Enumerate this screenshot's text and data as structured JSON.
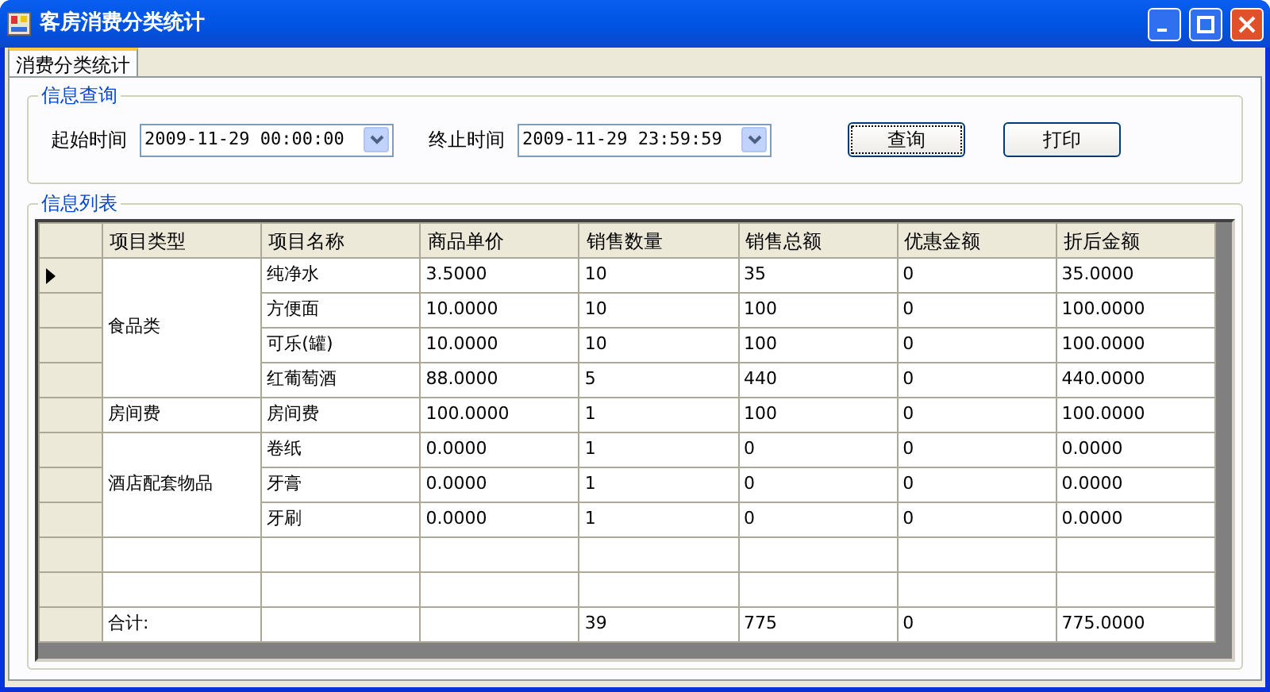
{
  "window": {
    "title": "客房消费分类统计"
  },
  "tabs": [
    {
      "label": "消费分类统计",
      "selected": true
    }
  ],
  "query": {
    "title": "信息查询",
    "start_label": "起始时间",
    "start_value": "2009-11-29 00:00:00",
    "end_label": "终止时间",
    "end_value": "2009-11-29 23:59:59",
    "buttons": [
      {
        "label": "查询",
        "focused": true
      },
      {
        "label": "打印",
        "focused": false
      }
    ]
  },
  "table": {
    "title": "信息列表",
    "columns": [
      "项目类型",
      "项目名称",
      "商品单价",
      "销售数量",
      "销售总额",
      "优惠金额",
      "折后金额"
    ],
    "rows": [
      {
        "kind": "group",
        "category": "食品类",
        "items": [
          {
            "cells": [
              "纯净水",
              "3.5000",
              "10",
              "35",
              "0",
              "35.0000"
            ],
            "current": true
          },
          {
            "cells": [
              "方便面",
              "10.0000",
              "10",
              "100",
              "0",
              "100.0000"
            ],
            "current": false
          },
          {
            "cells": [
              "可乐(罐)",
              "10.0000",
              "10",
              "100",
              "0",
              "100.0000"
            ],
            "current": false
          },
          {
            "cells": [
              "红葡萄酒",
              "88.0000",
              "5",
              "440",
              "0",
              "440.0000"
            ],
            "current": false
          }
        ]
      },
      {
        "kind": "group",
        "category": "房间费",
        "items": [
          {
            "cells": [
              "房间费",
              "100.0000",
              "1",
              "100",
              "0",
              "100.0000"
            ],
            "current": false
          }
        ]
      },
      {
        "kind": "group",
        "category": "酒店配套物品",
        "items": [
          {
            "cells": [
              "卷纸",
              "0.0000",
              "1",
              "0",
              "0",
              "0.0000"
            ],
            "current": false
          },
          {
            "cells": [
              "牙膏",
              "0.0000",
              "1",
              "0",
              "0",
              "0.0000"
            ],
            "current": false
          },
          {
            "cells": [
              "牙刷",
              "0.0000",
              "1",
              "0",
              "0",
              "0.0000"
            ],
            "current": false
          }
        ]
      },
      {
        "kind": "blank"
      },
      {
        "kind": "blank"
      },
      {
        "kind": "total",
        "label": "合计:",
        "cells": [
          "39",
          "775",
          "0",
          "775.0000"
        ]
      }
    ]
  }
}
